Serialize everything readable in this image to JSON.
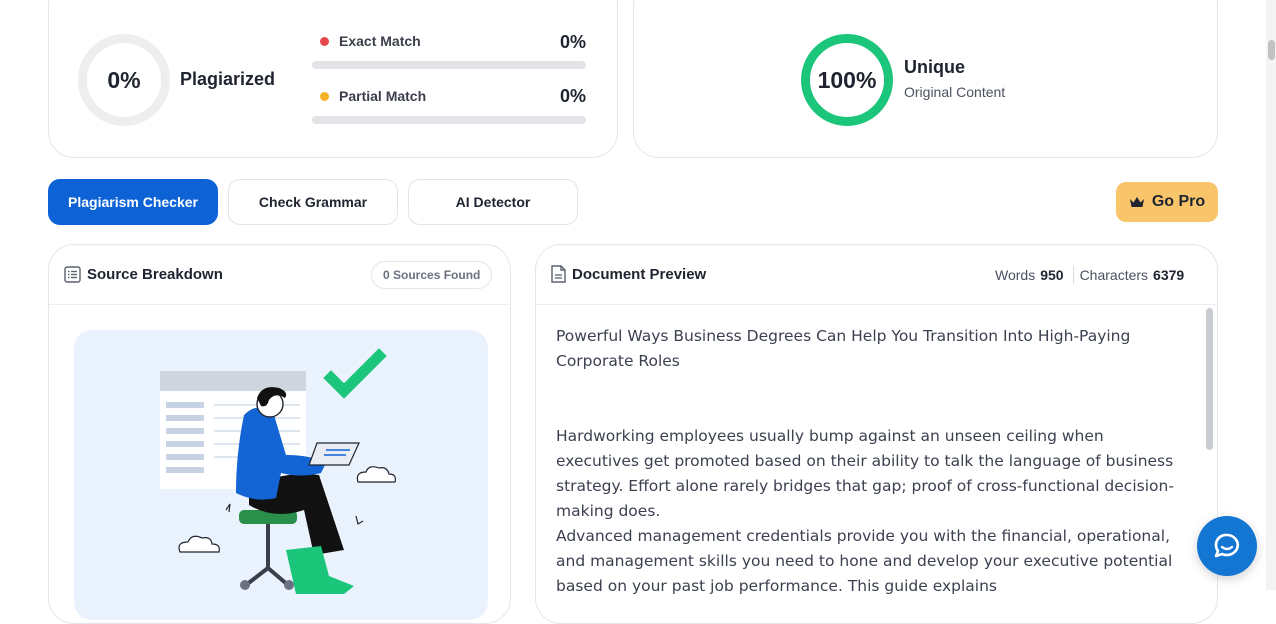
{
  "plagiarism": {
    "percent": "0%",
    "label": "Plagiarized",
    "exact_label": "Exact Match",
    "exact_value": "0%",
    "exact_fraction": 0,
    "partial_label": "Partial Match",
    "partial_value": "0%",
    "partial_fraction": 0
  },
  "unique": {
    "percent": "100%",
    "label": "Unique",
    "sublabel": "Original Content"
  },
  "tabs": [
    {
      "label": "Plagiarism Checker",
      "active": true
    },
    {
      "label": "Check Grammar",
      "active": false
    },
    {
      "label": "AI Detector",
      "active": false
    }
  ],
  "gopro": {
    "label": "Go Pro"
  },
  "source": {
    "title": "Source Breakdown",
    "badge": "0 Sources Found"
  },
  "preview": {
    "title": "Document Preview",
    "words_label": "Words",
    "words_value": "950",
    "chars_label": "Characters",
    "chars_value": "6379",
    "heading": "Powerful Ways Business Degrees Can Help You Transition Into High-Paying Corporate Roles",
    "para1": "Hardworking employees usually bump against an unseen ceiling when executives get promoted based on their ability to talk the language of business strategy. Effort alone rarely bridges that gap; proof of cross-functional decision-making does.",
    "para2": "Advanced management credentials provide you with the financial, operational, and management skills you need to hone and develop your executive potential based on your past job performance. This guide explains"
  },
  "colors": {
    "accent": "#0d63d6",
    "success": "#1bc67a",
    "exact_dot": "#e5484d",
    "partial_dot": "#f5b324",
    "gopro": "#f9c56b"
  },
  "icons": {
    "source": "list-icon",
    "preview": "document-icon",
    "gopro": "crown-icon",
    "chat": "chat-bubble-icon"
  }
}
